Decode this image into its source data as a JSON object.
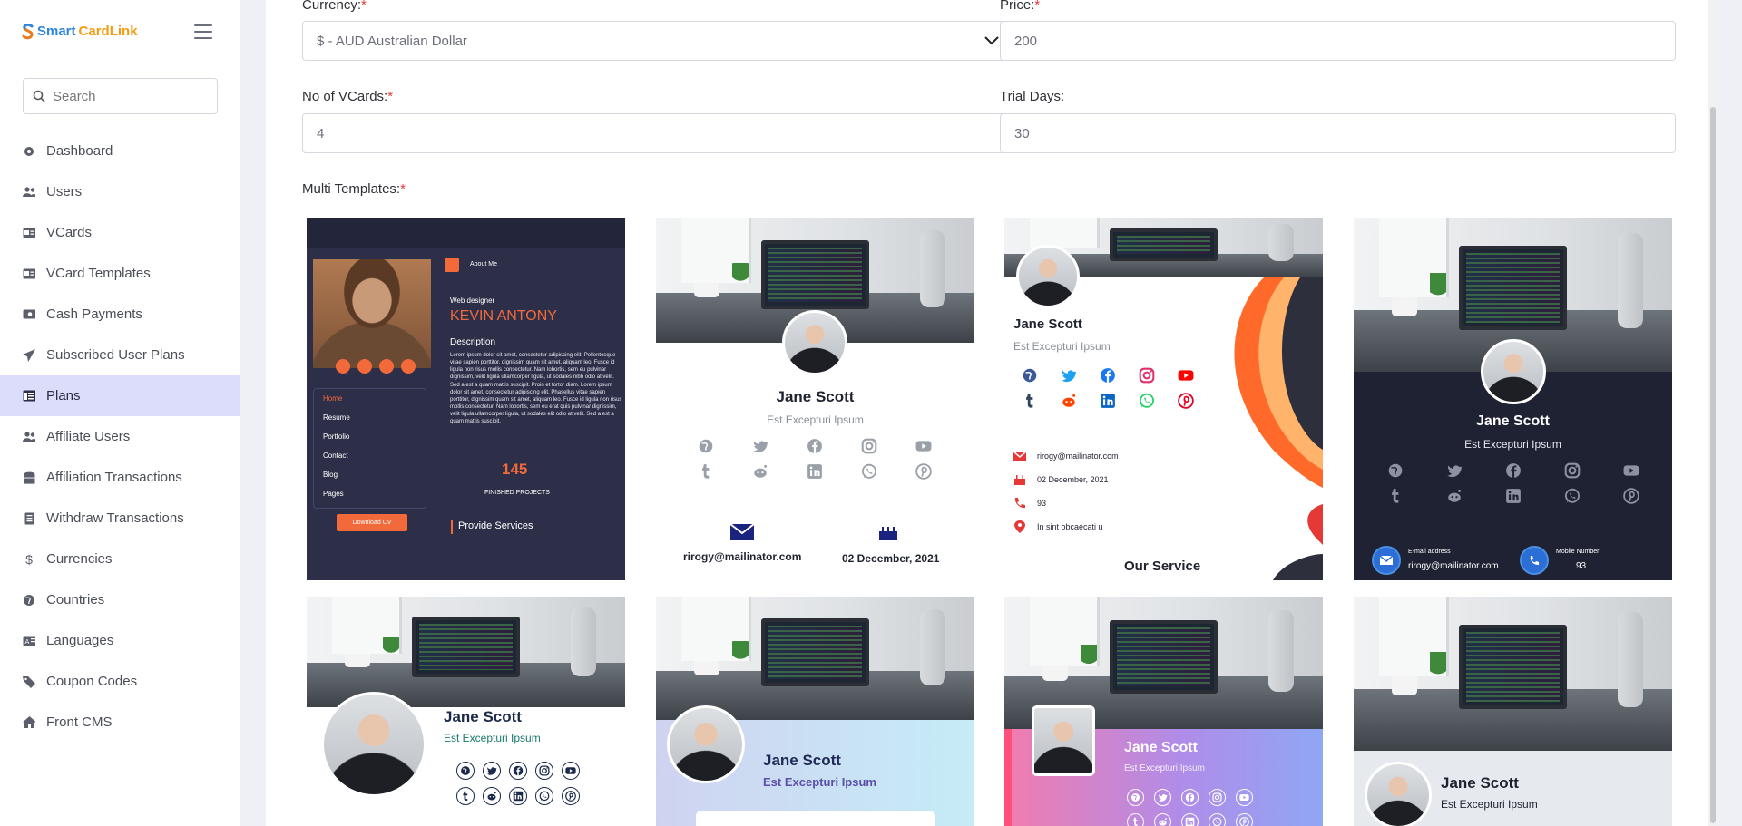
{
  "brand": {
    "name_part1": "Smart",
    "name_part2": "CardLink"
  },
  "search": {
    "placeholder": "Search"
  },
  "sidebar": {
    "items": [
      {
        "label": "Dashboard",
        "icon": "dashboard-icon"
      },
      {
        "label": "Users",
        "icon": "users-icon"
      },
      {
        "label": "VCards",
        "icon": "vcard-icon"
      },
      {
        "label": "VCard Templates",
        "icon": "vcard-templates-icon"
      },
      {
        "label": "Cash Payments",
        "icon": "cash-icon"
      },
      {
        "label": "Subscribed User Plans",
        "icon": "paper-plane-icon"
      },
      {
        "label": "Plans",
        "icon": "plans-icon",
        "active": true
      },
      {
        "label": "Affiliate Users",
        "icon": "users-icon"
      },
      {
        "label": "Affiliation Transactions",
        "icon": "coins-icon"
      },
      {
        "label": "Withdraw Transactions",
        "icon": "document-icon"
      },
      {
        "label": "Currencies",
        "icon": "dollar-icon"
      },
      {
        "label": "Countries",
        "icon": "globe-icon"
      },
      {
        "label": "Languages",
        "icon": "language-icon"
      },
      {
        "label": "Coupon Codes",
        "icon": "tag-icon"
      },
      {
        "label": "Front CMS",
        "icon": "home-icon"
      }
    ]
  },
  "form": {
    "currency_label": "Currency:",
    "currency_value": "$ - AUD Australian Dollar",
    "price_label": "Price:",
    "price_value": "200",
    "vcards_label": "No of VCards:",
    "vcards_value": "4",
    "trial_label": "Trial Days:",
    "trial_value": "30",
    "templates_label": "Multi Templates:",
    "required_mark": "*"
  },
  "templates": {
    "t1": {
      "about": "About Me",
      "role": "Web designer",
      "name": "KEVIN ANTONY",
      "description_title": "Description",
      "description": "Lorem ipsum dolor sit amet, consectetur adipiscing elit. Pellentesque vitae sapien porttitor, dignissim quam sit amet, aliquam leo. Fusce id ligula non risus mollis consectetur. Nam lobortis, sem eu pulvinar dignissim, velit ligula ullamcorper ligula, ut sodales nibh odio at velit. Sed a est a quam mattis suscipit. Proin et tortor diam. Lorem ipsum dolor sit amet, consectetur adipiscing elit. Phasellus vitae sapien porttitor, dignissim quam sit amet, aliquam leo. Fusce id ligula non risus mollis consectetur. Nam lobortis, sem eu erat quis pulvinar dignissim, velit ligula ullamcorper ligula, ut sodales elit odio at velit. Sed a est a quam mattis suscipit.",
      "menu": [
        "Home",
        "Resume",
        "Portfolio",
        "Contact",
        "Blog",
        "Pages"
      ],
      "count": "145",
      "count_label": "FINISHED PROJECTS",
      "download": "Download CV",
      "services": "Provide Services"
    },
    "common": {
      "name": "Jane Scott",
      "subtitle": "Est Excepturi Ipsum",
      "email": "rirogy@mailinator.com",
      "date": "02 December, 2021",
      "phone": "93",
      "address": "In sint obcaecati u"
    },
    "t3": {
      "service_title": "Our Service"
    },
    "t4": {
      "email_label": "E-mail address",
      "phone_label": "Mobile Number"
    },
    "colors": {
      "dark_navy": "#2d2f48",
      "card_navy": "#23253a",
      "orange": "#f26a3a",
      "accent": "#6571ff",
      "red": "#e53935"
    }
  }
}
